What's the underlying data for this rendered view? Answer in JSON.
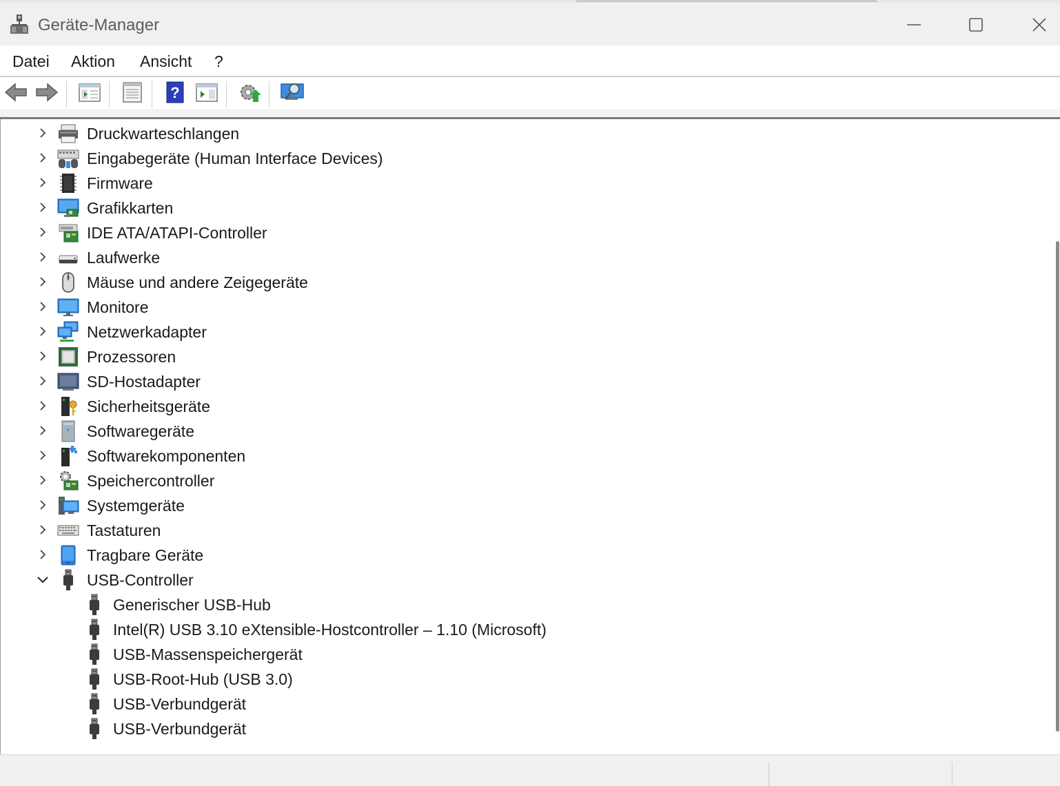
{
  "window": {
    "title": "Geräte-Manager",
    "controls": {
      "minimize_icon": "minimize-icon",
      "maximize_icon": "maximize-icon",
      "close_icon": "close-icon"
    }
  },
  "menu": {
    "items": [
      "Datei",
      "Aktion",
      "Ansicht",
      "?"
    ]
  },
  "toolbar": {
    "buttons": [
      "back-arrow-icon",
      "forward-arrow-icon",
      "show-hide-console-tree-icon",
      "properties-icon",
      "help-icon",
      "action-pane-icon",
      "update-driver-icon",
      "scan-hardware-icon"
    ]
  },
  "tree": {
    "categories": [
      {
        "label": "Druckwarteschlangen",
        "icon": "printer-icon",
        "expanded": false
      },
      {
        "label": "Eingabegeräte (Human Interface Devices)",
        "icon": "hid-icon",
        "expanded": false
      },
      {
        "label": "Firmware",
        "icon": "firmware-chip-icon",
        "expanded": false
      },
      {
        "label": "Grafikkarten",
        "icon": "display-adapter-icon",
        "expanded": false
      },
      {
        "label": "IDE ATA/ATAPI-Controller",
        "icon": "ide-controller-icon",
        "expanded": false
      },
      {
        "label": "Laufwerke",
        "icon": "disk-drive-icon",
        "expanded": false
      },
      {
        "label": "Mäuse und andere Zeigegeräte",
        "icon": "mouse-icon",
        "expanded": false
      },
      {
        "label": "Monitore",
        "icon": "monitor-icon",
        "expanded": false
      },
      {
        "label": "Netzwerkadapter",
        "icon": "network-adapter-icon",
        "expanded": false
      },
      {
        "label": "Prozessoren",
        "icon": "processor-icon",
        "expanded": false
      },
      {
        "label": "SD-Hostadapter",
        "icon": "sd-host-icon",
        "expanded": false
      },
      {
        "label": "Sicherheitsgeräte",
        "icon": "security-device-icon",
        "expanded": false
      },
      {
        "label": "Softwaregeräte",
        "icon": "software-device-icon",
        "expanded": false
      },
      {
        "label": "Softwarekomponenten",
        "icon": "software-component-icon",
        "expanded": false
      },
      {
        "label": "Speichercontroller",
        "icon": "storage-controller-icon",
        "expanded": false
      },
      {
        "label": "Systemgeräte",
        "icon": "system-device-icon",
        "expanded": false
      },
      {
        "label": "Tastaturen",
        "icon": "keyboard-icon",
        "expanded": false
      },
      {
        "label": "Tragbare Geräte",
        "icon": "portable-device-icon",
        "expanded": false
      },
      {
        "label": "USB-Controller",
        "icon": "usb-icon",
        "expanded": true
      }
    ],
    "usb_children": [
      {
        "label": "Generischer USB-Hub",
        "icon": "usb-icon"
      },
      {
        "label": "Intel(R) USB 3.10 eXtensible-Hostcontroller – 1.10 (Microsoft)",
        "icon": "usb-icon"
      },
      {
        "label": "USB-Massenspeichergerät",
        "icon": "usb-icon"
      },
      {
        "label": "USB-Root-Hub (USB 3.0)",
        "icon": "usb-icon"
      },
      {
        "label": "USB-Verbundgerät",
        "icon": "usb-icon"
      },
      {
        "label": "USB-Verbundgerät",
        "icon": "usb-icon"
      }
    ]
  },
  "colors": {
    "accent_blue": "#1e90e0",
    "text": "#1a1a1a",
    "title_text": "#5c5c5c"
  }
}
